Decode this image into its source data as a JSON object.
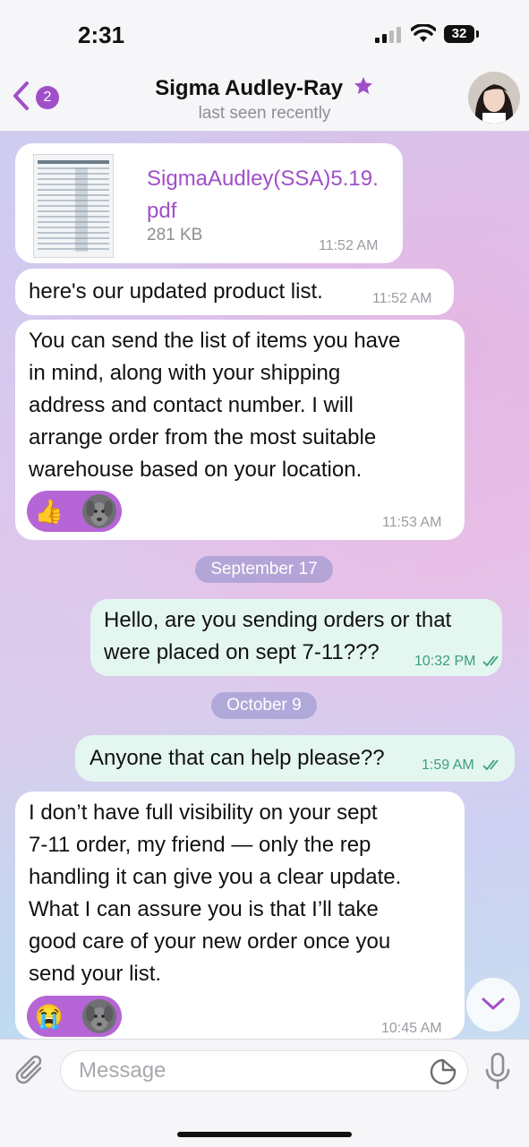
{
  "status_bar": {
    "time": "2:31",
    "battery": "32"
  },
  "header": {
    "back_badge": "2",
    "contact_name": "Sigma Audley-Ray",
    "last_seen": "last seen recently"
  },
  "messages": [
    {
      "file_name": "SigmaAudley(SSA)5.19.",
      "file_name_2": "pdf",
      "file_size": "281 KB",
      "time": "11:52 AM"
    },
    {
      "text": "here's our updated product list.",
      "time": "11:52 AM"
    },
    {
      "lines": [
        "You can send the list of items you have",
        "in mind, along with your shipping",
        "address and contact number. I will",
        "arrange order from the most suitable",
        "warehouse based on your location."
      ],
      "reactions": [
        "👍"
      ],
      "time": "11:53 AM"
    },
    {
      "lines": [
        "Hello, are you sending orders or that",
        "were placed on sept 7-11???"
      ],
      "time": "10:32 PM"
    },
    {
      "lines": [
        "Anyone that can help please??"
      ],
      "time": "1:59 AM"
    },
    {
      "lines": [
        "I don’t have full visibility on your sept",
        "7-11 order, my friend — only the rep",
        "handling it can give you a clear update.",
        "What I can assure you is that I’ll take",
        "good care of your new order once you",
        "send your list."
      ],
      "reactions": [
        "😭"
      ],
      "time": "10:45 AM"
    }
  ],
  "dates": [
    "September 17",
    "October 9"
  ],
  "input": {
    "placeholder": "Message"
  },
  "colors": {
    "accent": "#a04fc8",
    "outgoing_bubble": "#e4f6f0",
    "incoming_bubble": "#ffffff"
  },
  "icons": [
    "back-chevron-icon",
    "star-icon",
    "attach-icon",
    "sticker-icon",
    "microphone-icon",
    "chevron-down-icon",
    "double-check-icon"
  ]
}
